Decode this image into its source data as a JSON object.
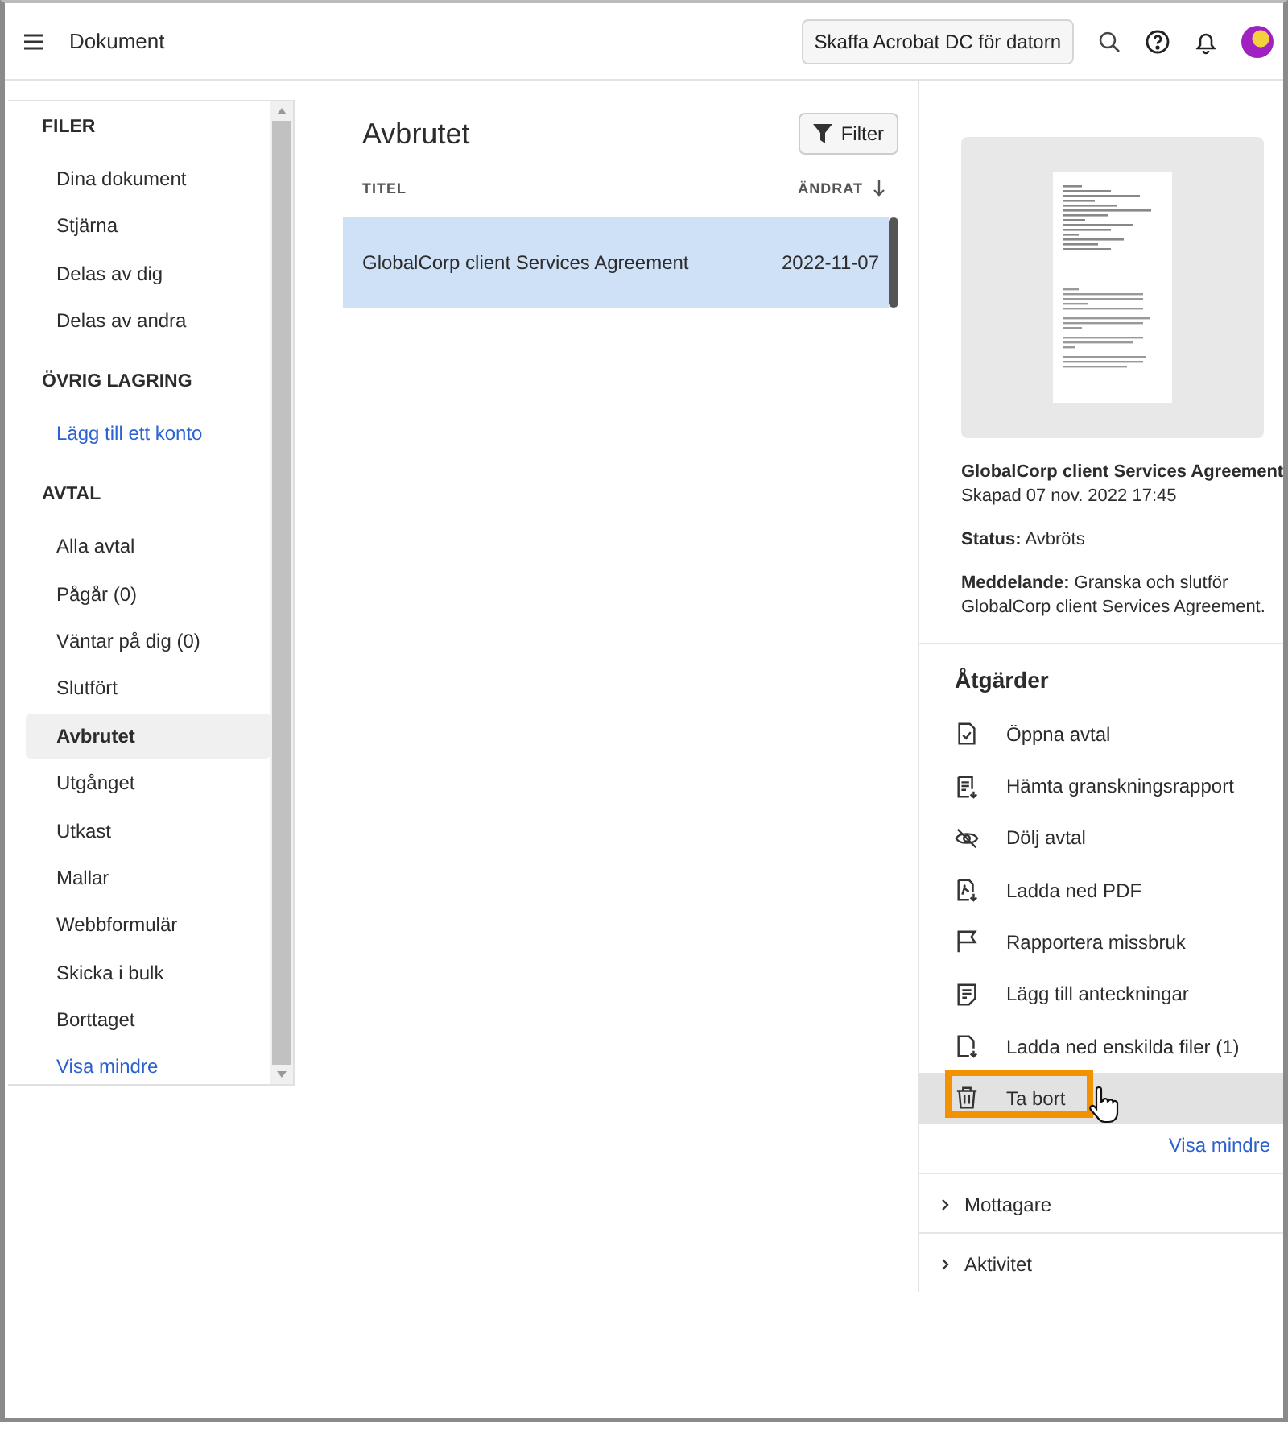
{
  "header": {
    "title": "Dokument",
    "cta": "Skaffa Acrobat DC för datorn"
  },
  "sidebar": {
    "sections": [
      {
        "heading": "FILER",
        "items": [
          {
            "label": "Dina dokument",
            "kind": "item",
            "selected": false
          },
          {
            "label": "Stjärna",
            "kind": "item",
            "selected": false
          },
          {
            "label": "Delas av dig",
            "kind": "item",
            "selected": false
          },
          {
            "label": "Delas av andra",
            "kind": "item",
            "selected": false
          }
        ]
      },
      {
        "heading": "ÖVRIG LAGRING",
        "items": [
          {
            "label": "Lägg till ett konto",
            "kind": "link",
            "selected": false
          }
        ]
      },
      {
        "heading": "AVTAL",
        "items": [
          {
            "label": "Alla avtal",
            "kind": "item",
            "selected": false
          },
          {
            "label": "Pågår (0)",
            "kind": "item",
            "selected": false
          },
          {
            "label": "Väntar på dig (0)",
            "kind": "item",
            "selected": false
          },
          {
            "label": "Slutfört",
            "kind": "item",
            "selected": false
          },
          {
            "label": "Avbrutet",
            "kind": "item",
            "selected": true
          },
          {
            "label": "Utgånget",
            "kind": "item",
            "selected": false
          },
          {
            "label": "Utkast",
            "kind": "item",
            "selected": false
          },
          {
            "label": "Mallar",
            "kind": "item",
            "selected": false
          },
          {
            "label": "Webbformulär",
            "kind": "item",
            "selected": false
          },
          {
            "label": "Skicka i bulk",
            "kind": "item",
            "selected": false
          },
          {
            "label": "Borttaget",
            "kind": "item",
            "selected": false
          },
          {
            "label": "Visa mindre",
            "kind": "link",
            "selected": false
          }
        ]
      }
    ]
  },
  "list": {
    "title": "Avbrutet",
    "filter": "Filter",
    "columns": [
      "TITEL",
      "ÄNDRAT"
    ],
    "rows": [
      {
        "title": "GlobalCorp client Services Agreement",
        "modified": "2022-11-07",
        "selected": true
      }
    ]
  },
  "details": {
    "name": "GlobalCorp client Services Agreement",
    "created": "Skapad 07 nov. 2022 17:45",
    "status_label": "Status:",
    "status": "Avbröts",
    "message_label": "Meddelande:",
    "message": "Granska och slutför GlobalCorp client Services Agreement.",
    "actions_title": "Åtgärder",
    "actions": [
      {
        "label": "Öppna avtal",
        "kind": "open",
        "hovered": false,
        "highlighted": false
      },
      {
        "label": "Hämta granskningsrapport",
        "kind": "report",
        "hovered": false,
        "highlighted": false
      },
      {
        "label": "Dölj avtal",
        "kind": "hide",
        "hovered": false,
        "highlighted": false
      },
      {
        "label": "Ladda ned PDF",
        "kind": "pdf",
        "hovered": false,
        "highlighted": false
      },
      {
        "label": "Rapportera missbruk",
        "kind": "flag",
        "hovered": false,
        "highlighted": false
      },
      {
        "label": "Lägg till anteckningar",
        "kind": "notes",
        "hovered": false,
        "highlighted": false
      },
      {
        "label": "Ladda ned enskilda filer (1)",
        "kind": "files",
        "hovered": false,
        "highlighted": false
      },
      {
        "label": "Ta bort",
        "kind": "delete",
        "hovered": true,
        "highlighted": true
      }
    ],
    "show_less": "Visa mindre",
    "sections": [
      {
        "label": "Mottagare",
        "expanded": false
      },
      {
        "label": "Aktivitet",
        "expanded": false
      }
    ]
  }
}
